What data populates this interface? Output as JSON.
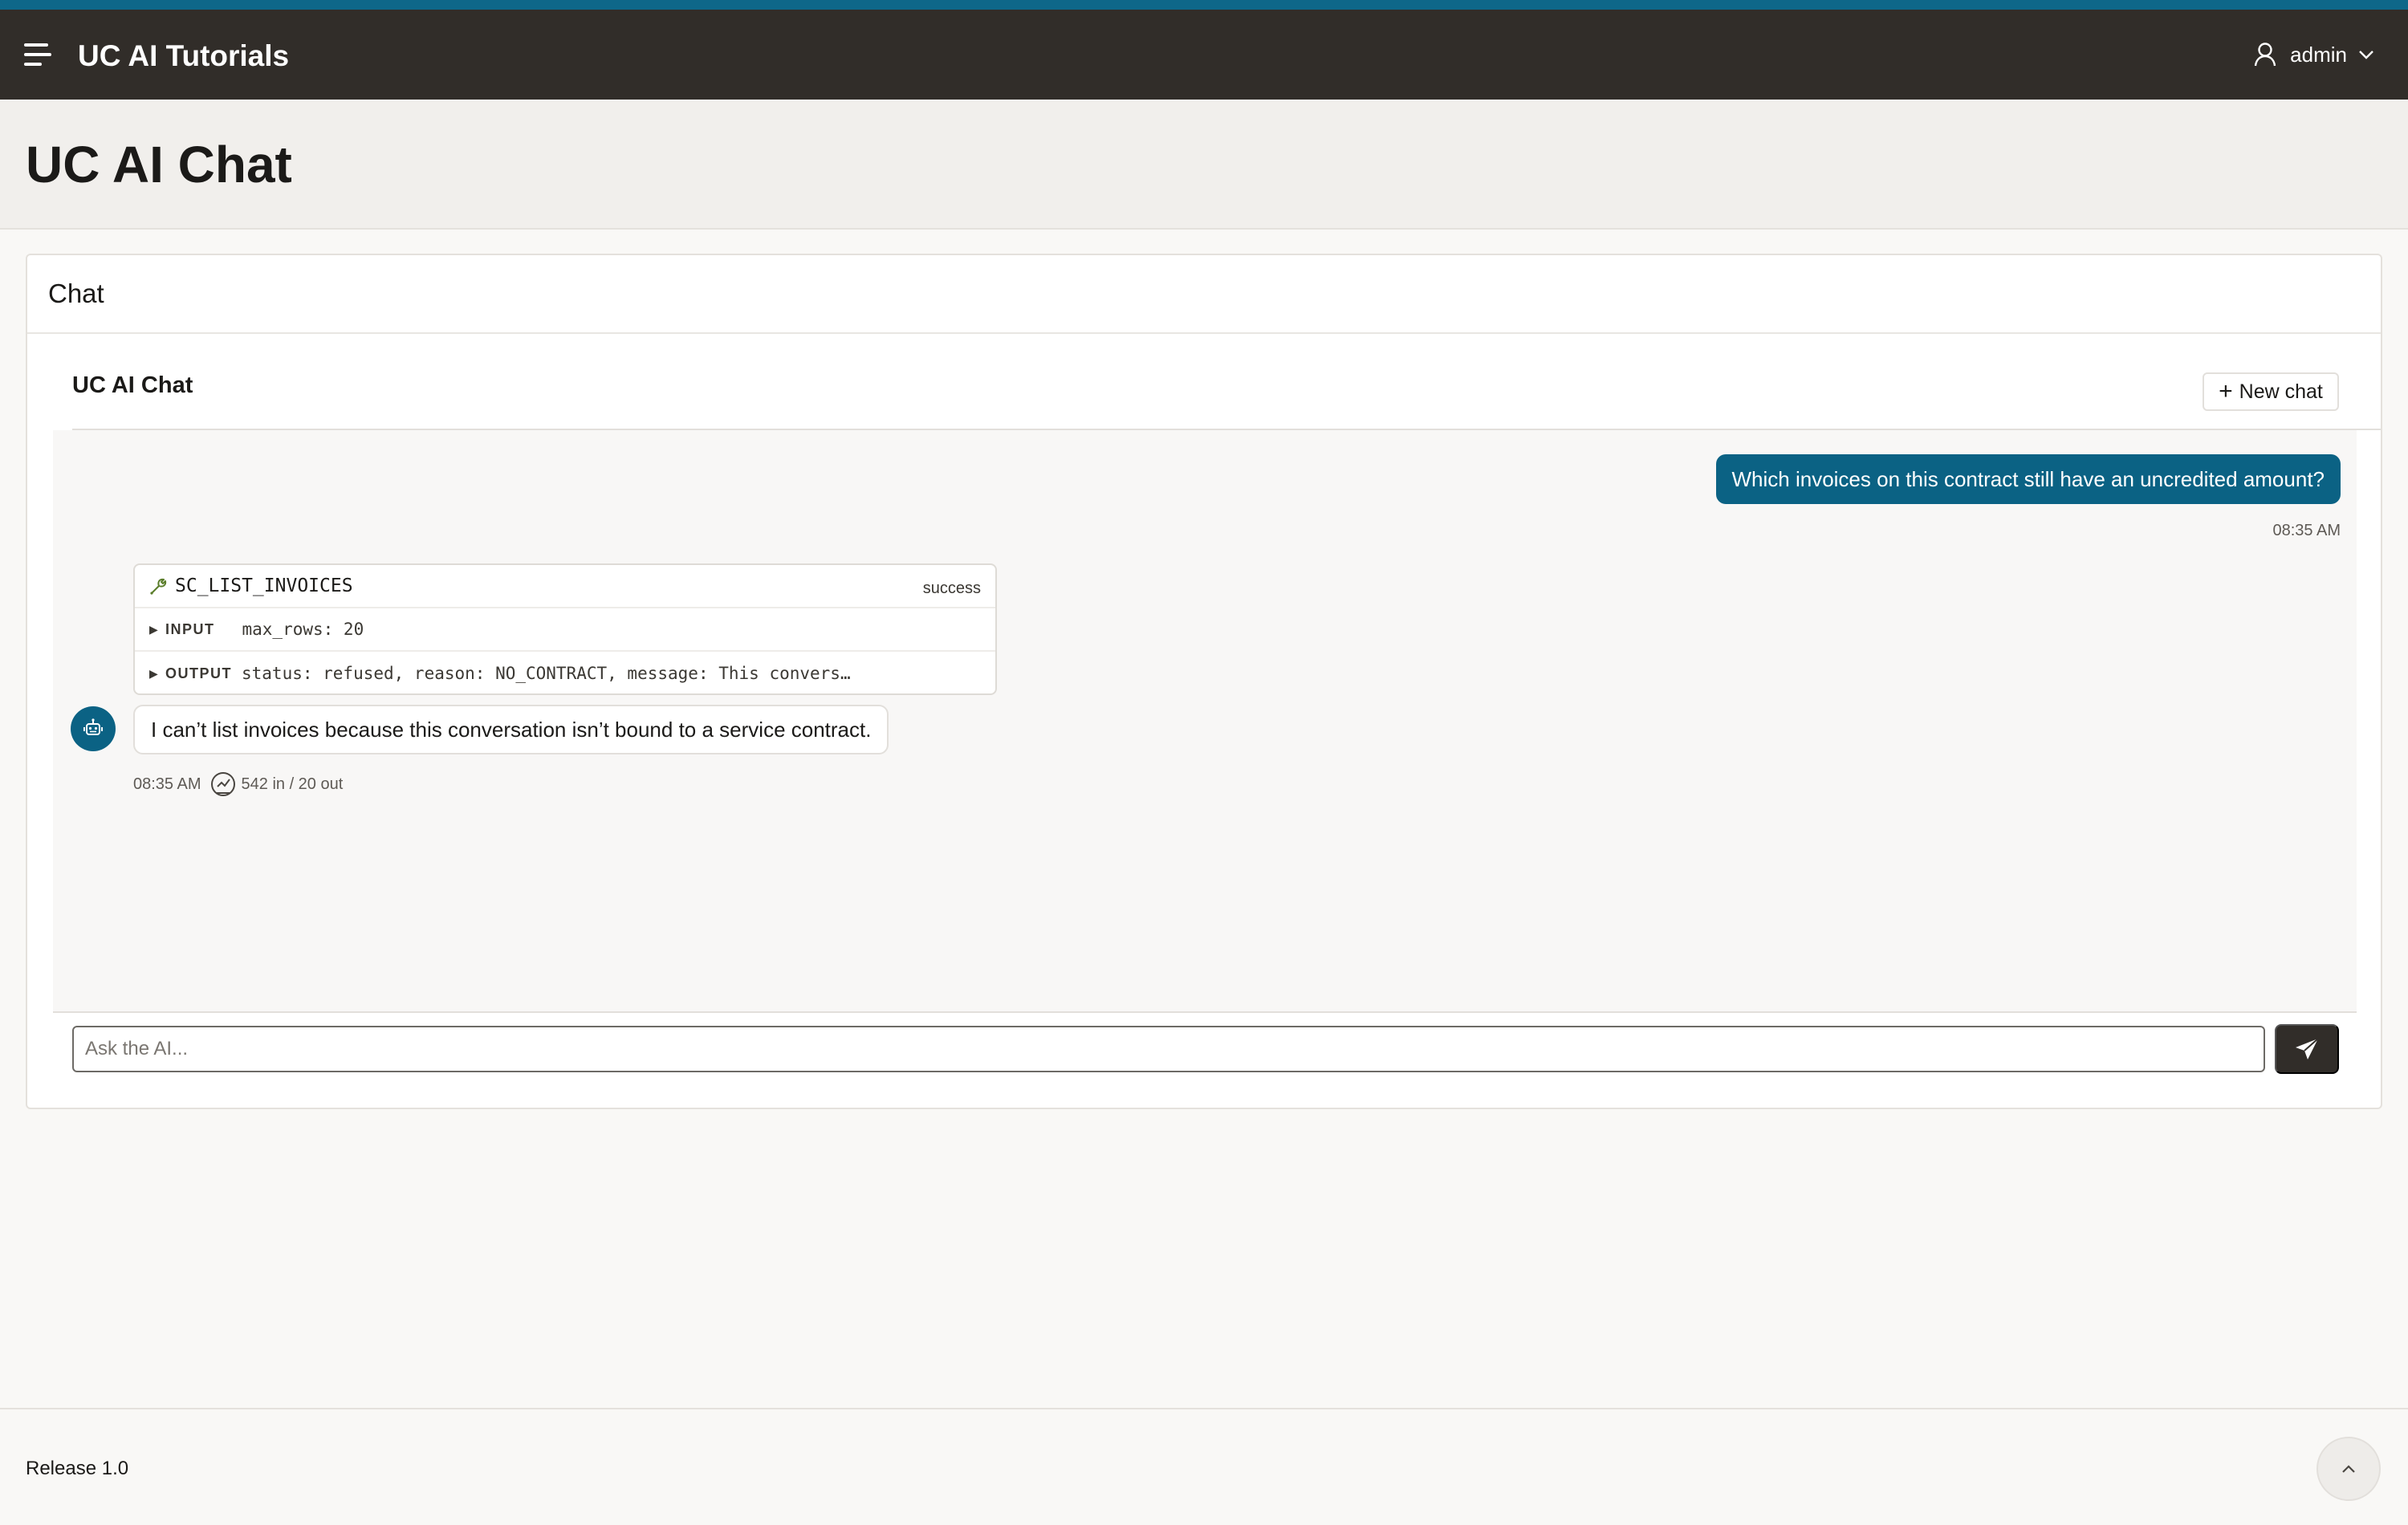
{
  "navbar": {
    "app_title": "UC AI Tutorials",
    "user_name": "admin"
  },
  "page": {
    "title": "UC AI Chat"
  },
  "region": {
    "title": "Chat"
  },
  "chat": {
    "title": "UC AI Chat",
    "new_chat_label": "New chat",
    "user_message": {
      "text": "Which invoices on this contract still have an uncredited amount?",
      "time": "08:35 AM"
    },
    "tool_call": {
      "name": "SC_LIST_INVOICES",
      "status": "success",
      "input_label": "INPUT",
      "input_value": "max_rows: 20",
      "output_label": "OUTPUT",
      "output_value": "status: refused, reason: NO_CONTRACT, message: This convers…"
    },
    "assistant_message": {
      "text": "I can’t list invoices because this conversation isn’t bound to a service contract.",
      "time": "08:35 AM",
      "tokens": "542 in / 20 out"
    },
    "input_placeholder": "Ask the AI..."
  },
  "footer": {
    "release": "Release 1.0"
  },
  "colors": {
    "accent": "#0b6284",
    "header_bg": "#312d29",
    "top_stripe": "#0e6789"
  },
  "icons": [
    "menu-icon",
    "user-icon",
    "chevron-down-icon",
    "plus-icon",
    "wrench-icon",
    "triangle-right-icon",
    "robot-icon",
    "gauge-icon",
    "send-icon",
    "chevron-up-icon"
  ]
}
